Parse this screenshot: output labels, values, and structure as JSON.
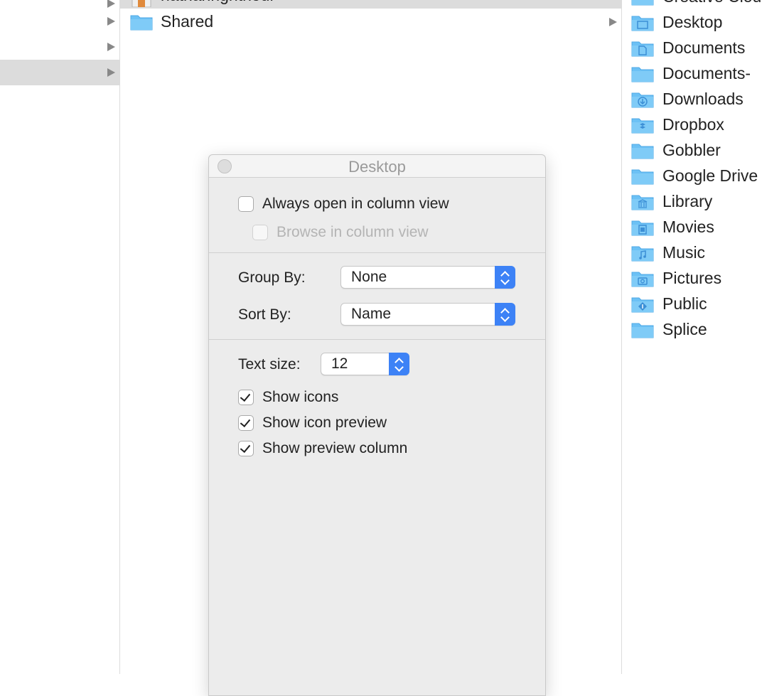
{
  "column1": {
    "rows": [
      {
        "has_arrow": true,
        "selected": false
      },
      {
        "has_arrow": true,
        "selected": false
      },
      {
        "has_arrow": true,
        "selected": true
      }
    ]
  },
  "column2": {
    "items": [
      {
        "label": "nathanrightnour",
        "selected": true,
        "has_arrow": false
      },
      {
        "label": "Shared",
        "selected": false,
        "has_arrow": true
      }
    ]
  },
  "column3": {
    "items": [
      {
        "label": "Creative Clou",
        "icon": "folder-icon"
      },
      {
        "label": "Desktop",
        "icon": "desktop-folder-icon"
      },
      {
        "label": "Documents",
        "icon": "documents-folder-icon"
      },
      {
        "label": "Documents-",
        "icon": "folder-icon"
      },
      {
        "label": "Downloads",
        "icon": "downloads-folder-icon"
      },
      {
        "label": "Dropbox",
        "icon": "dropbox-folder-icon"
      },
      {
        "label": "Gobbler",
        "icon": "folder-icon"
      },
      {
        "label": "Google Drive",
        "icon": "folder-icon"
      },
      {
        "label": "Library",
        "icon": "library-folder-icon"
      },
      {
        "label": "Movies",
        "icon": "movies-folder-icon"
      },
      {
        "label": "Music",
        "icon": "music-folder-icon"
      },
      {
        "label": "Pictures",
        "icon": "pictures-folder-icon"
      },
      {
        "label": "Public",
        "icon": "public-folder-icon"
      },
      {
        "label": "Splice",
        "icon": "folder-icon"
      }
    ]
  },
  "dialog": {
    "title": "Desktop",
    "always_open_column_view": {
      "label": "Always open in column view",
      "checked": false
    },
    "browse_column_view": {
      "label": "Browse in column view",
      "checked": false,
      "disabled": true
    },
    "group_by": {
      "label": "Group By:",
      "value": "None"
    },
    "sort_by": {
      "label": "Sort By:",
      "value": "Name"
    },
    "text_size": {
      "label": "Text size:",
      "value": "12"
    },
    "show_icons": {
      "label": "Show icons",
      "checked": true
    },
    "show_icon_preview": {
      "label": "Show icon preview",
      "checked": true
    },
    "show_preview_column": {
      "label": "Show preview column",
      "checked": true
    }
  },
  "colors": {
    "accent": "#3d82f6",
    "folder": "#6cc1f5",
    "selection": "#dcdcdc"
  }
}
